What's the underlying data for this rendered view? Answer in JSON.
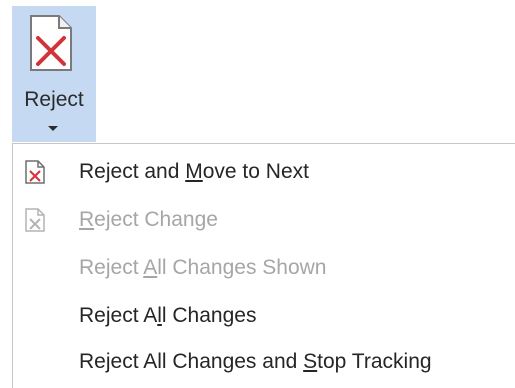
{
  "ribbon": {
    "button_label": "Reject",
    "icon": "reject-document-icon",
    "accent_bg": "#c5daf2"
  },
  "menu": {
    "items": [
      {
        "before": "Reject and ",
        "key": "M",
        "after": "ove to Next",
        "icon": "reject-document-icon",
        "enabled": true
      },
      {
        "before": "",
        "key": "R",
        "after": "eject Change",
        "icon": "reject-document-icon",
        "enabled": false
      },
      {
        "before": "Reject ",
        "key": "A",
        "after": "ll Changes Shown",
        "icon": "",
        "enabled": false
      },
      {
        "before": "Reject A",
        "key": "l",
        "after": "l Changes",
        "icon": "",
        "enabled": true
      },
      {
        "before": "Reject All Changes and ",
        "key": "S",
        "after": "top Tracking",
        "icon": "",
        "enabled": true
      }
    ]
  },
  "colors": {
    "reject_red": "#d13438",
    "enabled_text": "#262626",
    "disabled_text": "#a6a6a6"
  }
}
